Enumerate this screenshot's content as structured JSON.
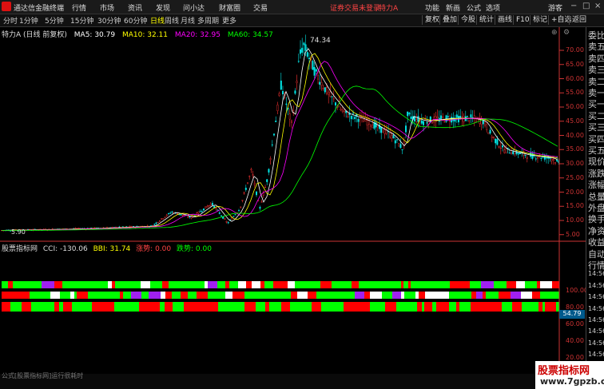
{
  "app": {
    "name": "通达信金融终端",
    "menu": [
      "行情",
      "市场",
      "资讯",
      "发现",
      "问小达",
      "财富圈",
      "交易"
    ],
    "notice": "证券交易未登录",
    "stock_title": "特力A",
    "right_menu": [
      "功能",
      "新画",
      "公式",
      "选项",
      "游客"
    ]
  },
  "periods": [
    "分时",
    "1分钟",
    "5分钟",
    "15分钟",
    "30分钟",
    "60分钟",
    "日线",
    "周线",
    "月线",
    "多周期",
    "更多"
  ],
  "active_period": "日线",
  "tools": [
    "复权",
    "叠加",
    "今股",
    "统计",
    "画线",
    "F10",
    "标记",
    "+自选",
    "返回"
  ],
  "chart_header": {
    "title": "特力A (日线 前复权)",
    "ma5": "MA5: 30.79",
    "ma10": "MA10: 32.11",
    "ma20": "MA20: 32.95",
    "ma60": "MA60: 34.57"
  },
  "price_axis": [
    "70.00",
    "65.00",
    "60.00",
    "55.00",
    "50.00",
    "45.00",
    "40.00",
    "35.00",
    "30.00",
    "25.00",
    "20.00",
    "15.00",
    "10.00",
    "5.00"
  ],
  "max_label": "74.34",
  "min_label": "5.90",
  "indicator_header": {
    "name": "股票指标网",
    "cci": "CCI: -130.06",
    "bbi": "BBI: 31.74",
    "up": "涨势: 0.00",
    "down": "跌势: 0.00"
  },
  "indicator_axis": [
    "100.00",
    "80.00",
    "60.00",
    "40.00",
    "20.00"
  ],
  "indicator_current": "54.79",
  "time_axis": [
    "2014年",
    "12",
    "11",
    "12",
    "12",
    "1",
    "12",
    "1",
    "12"
  ],
  "side_labels": [
    "委比",
    "卖五",
    "卖四",
    "卖三",
    "卖二",
    "卖一",
    "买一",
    "买二",
    "买三",
    "买四",
    "买五",
    "现价",
    "涨跌",
    "涨幅",
    "总量",
    "外盘",
    "换手",
    "净资",
    "收益",
    "自动",
    "行情",
    "14:56",
    "14:56",
    "14:56",
    "14:56",
    "14:56",
    "14:56",
    "14:56",
    "14:56",
    "14:56"
  ],
  "status_text": "公式[股票指标网]运行很耗时",
  "watermark": {
    "line1": "股票指标网",
    "line2": "www.7gpzb.com"
  },
  "colors": {
    "up": "#ff3232",
    "down": "#00e6e6",
    "ma5": "#ffffff",
    "ma10": "#ffff00",
    "ma20": "#ff00ff",
    "ma60": "#00ff00",
    "bar_green": "#00ff00",
    "bar_red": "#ff0000",
    "bar_white": "#ffffff",
    "bar_purple": "#a020f0"
  }
}
